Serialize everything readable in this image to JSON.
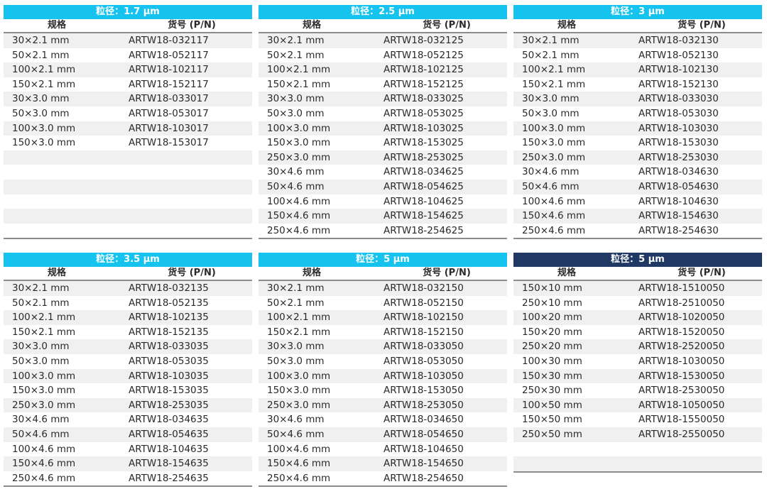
{
  "tables": [
    {
      "title": "粒径：1.7 μm",
      "header": {
        "spec": "规格",
        "pn": "货号 (P/N)"
      },
      "rows": [
        [
          "30×2.1 mm",
          "ARTW18-032117"
        ],
        [
          "50×2.1 mm",
          "ARTW18-052117"
        ],
        [
          "100×2.1 mm",
          "ARTW18-102117"
        ],
        [
          "150×2.1 mm",
          "ARTW18-152117"
        ],
        [
          "30×3.0 mm",
          "ARTW18-033017"
        ],
        [
          "50×3.0 mm",
          "ARTW18-053017"
        ],
        [
          "100×3.0 mm",
          "ARTW18-103017"
        ],
        [
          "150×3.0 mm",
          "ARTW18-153017"
        ]
      ],
      "total_rows": 14
    },
    {
      "title": "粒径：2.5 μm",
      "header": {
        "spec": "规格",
        "pn": "货号 (P/N)"
      },
      "rows": [
        [
          "30×2.1 mm",
          "ARTW18-032125"
        ],
        [
          "50×2.1 mm",
          "ARTW18-052125"
        ],
        [
          "100×2.1 mm",
          "ARTW18-102125"
        ],
        [
          "150×2.1 mm",
          "ARTW18-152125"
        ],
        [
          "30×3.0 mm",
          "ARTW18-033025"
        ],
        [
          "50×3.0 mm",
          "ARTW18-053025"
        ],
        [
          "100×3.0 mm",
          "ARTW18-103025"
        ],
        [
          "150×3.0 mm",
          "ARTW18-153025"
        ],
        [
          "250×3.0 mm",
          "ARTW18-253025"
        ],
        [
          "30×4.6 mm",
          "ARTW18-034625"
        ],
        [
          "50×4.6 mm",
          "ARTW18-054625"
        ],
        [
          "100×4.6 mm",
          "ARTW18-104625"
        ],
        [
          "150×4.6 mm",
          "ARTW18-154625"
        ],
        [
          "250×4.6 mm",
          "ARTW18-254625"
        ]
      ],
      "total_rows": 14
    },
    {
      "title": "粒径：3 μm",
      "header": {
        "spec": "规格",
        "pn": "货号 (P/N)"
      },
      "rows": [
        [
          "30×2.1 mm",
          "ARTW18-032130"
        ],
        [
          "50×2.1 mm",
          "ARTW18-052130"
        ],
        [
          "100×2.1 mm",
          "ARTW18-102130"
        ],
        [
          "150×2.1 mm",
          "ARTW18-152130"
        ],
        [
          "30×3.0 mm",
          "ARTW18-033030"
        ],
        [
          "50×3.0 mm",
          "ARTW18-053030"
        ],
        [
          "100×3.0 mm",
          "ARTW18-103030"
        ],
        [
          "150×3.0 mm",
          "ARTW18-153030"
        ],
        [
          "250×3.0 mm",
          "ARTW18-253030"
        ],
        [
          "30×4.6 mm",
          "ARTW18-034630"
        ],
        [
          "50×4.6 mm",
          "ARTW18-054630"
        ],
        [
          "100×4.6 mm",
          "ARTW18-104630"
        ],
        [
          "150×4.6 mm",
          "ARTW18-154630"
        ],
        [
          "250×4.6 mm",
          "ARTW18-254630"
        ]
      ],
      "total_rows": 14
    },
    {
      "title": "粒径：3.5 μm",
      "header": {
        "spec": "规格",
        "pn": "货号 (P/N)"
      },
      "rows": [
        [
          "30×2.1 mm",
          "ARTW18-032135"
        ],
        [
          "50×2.1 mm",
          "ARTW18-052135"
        ],
        [
          "100×2.1 mm",
          "ARTW18-102135"
        ],
        [
          "150×2.1 mm",
          "ARTW18-152135"
        ],
        [
          "30×3.0 mm",
          "ARTW18-033035"
        ],
        [
          "50×3.0 mm",
          "ARTW18-053035"
        ],
        [
          "100×3.0 mm",
          "ARTW18-103035"
        ],
        [
          "150×3.0 mm",
          "ARTW18-153035"
        ],
        [
          "250×3.0 mm",
          "ARTW18-253035"
        ],
        [
          "30×4.6 mm",
          "ARTW18-034635"
        ],
        [
          "50×4.6 mm",
          "ARTW18-054635"
        ],
        [
          "100×4.6 mm",
          "ARTW18-104635"
        ],
        [
          "150×4.6 mm",
          "ARTW18-154635"
        ],
        [
          "250×4.6 mm",
          "ARTW18-254635"
        ]
      ],
      "total_rows": 14
    },
    {
      "title": "粒径：5 μm",
      "header": {
        "spec": "规格",
        "pn": "货号 (P/N)"
      },
      "rows": [
        [
          "30×2.1 mm",
          "ARTW18-032150"
        ],
        [
          "50×2.1 mm",
          "ARTW18-052150"
        ],
        [
          "100×2.1 mm",
          "ARTW18-102150"
        ],
        [
          "150×2.1 mm",
          "ARTW18-152150"
        ],
        [
          "30×3.0 mm",
          "ARTW18-033050"
        ],
        [
          "50×3.0 mm",
          "ARTW18-053050"
        ],
        [
          "100×3.0 mm",
          "ARTW18-103050"
        ],
        [
          "150×3.0 mm",
          "ARTW18-153050"
        ],
        [
          "250×3.0 mm",
          "ARTW18-253050"
        ],
        [
          "30×4.6 mm",
          "ARTW18-034650"
        ],
        [
          "50×4.6 mm",
          "ARTW18-054650"
        ],
        [
          "100×4.6 mm",
          "ARTW18-104650"
        ],
        [
          "150×4.6 mm",
          "ARTW18-154650"
        ],
        [
          "250×4.6 mm",
          "ARTW18-254650"
        ]
      ],
      "total_rows": 14
    },
    {
      "title": "粒径：5 μm",
      "header": {
        "spec": "规格",
        "pn": "货号 (P/N)"
      },
      "rows": [
        [
          "150×10 mm",
          "ARTW18-1510050"
        ],
        [
          "250×10 mm",
          "ARTW18-2510050"
        ],
        [
          "100×20 mm",
          "ARTW18-1020050"
        ],
        [
          "150×20 mm",
          "ARTW18-1520050"
        ],
        [
          "250×20 mm",
          "ARTW18-2520050"
        ],
        [
          "100×30 mm",
          "ARTW18-1030050"
        ],
        [
          "150×30 mm",
          "ARTW18-1530050"
        ],
        [
          "250×30 mm",
          "ARTW18-2530050"
        ],
        [
          "100×50 mm",
          "ARTW18-1050050"
        ],
        [
          "150×50 mm",
          "ARTW18-1550050"
        ],
        [
          "250×50 mm",
          "ARTW18-2550050"
        ]
      ],
      "total_rows": 13
    }
  ],
  "colors": {
    "title_cyan": "#16c3ee",
    "title_navy": "#1f3864",
    "stripe": "#f0f0f0",
    "rule": "#8c8c8c"
  }
}
